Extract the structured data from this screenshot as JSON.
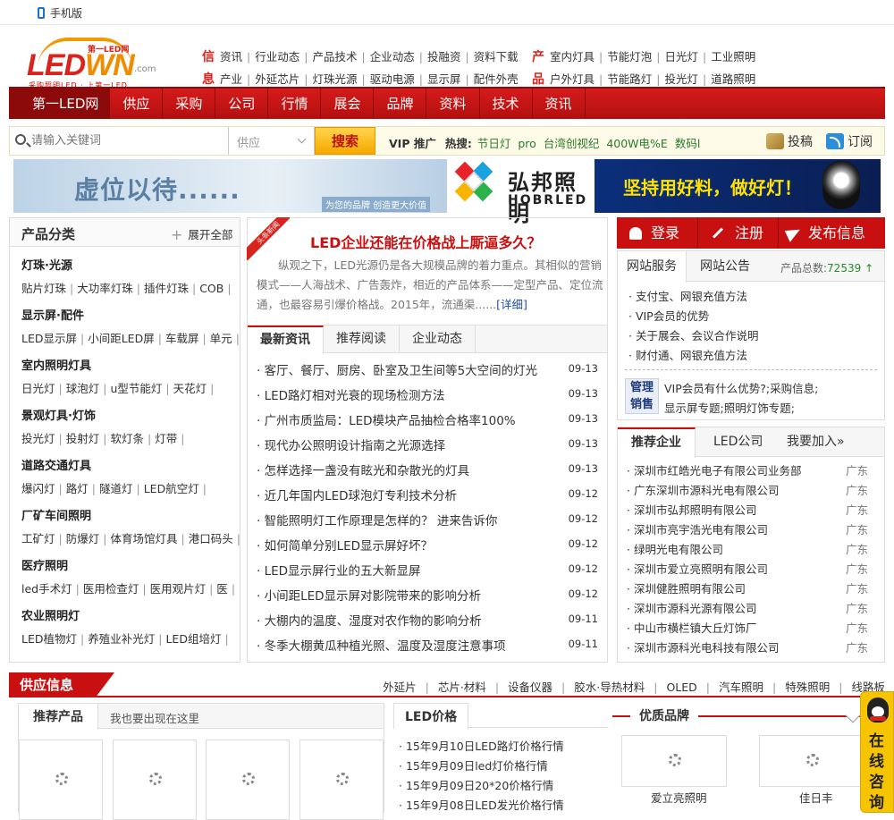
{
  "topbar": {
    "mobile_label": "手机版"
  },
  "logo": {
    "text_a": "LED",
    "text_b": "WN",
    "cn_text": "第一LED网",
    "com": ".com",
    "slogan": "采购照明LED · 上第一LED"
  },
  "header_links": {
    "xin_tag": "信",
    "xin_items": [
      "资讯",
      "行业动态",
      "产品技术",
      "企业动态",
      "投融资",
      "资料下载"
    ],
    "xi_tag": "息",
    "xi_items": [
      "产业",
      "外延芯片",
      "灯珠光源",
      "驱动电源",
      "显示屏",
      "配件外壳"
    ],
    "chan_tag": "产",
    "chan_items": [
      "室内灯具",
      "节能灯泡",
      "日光灯",
      "工业照明"
    ],
    "pin_tag": "品",
    "pin_items": [
      "户外灯具",
      "节能路灯",
      "投光灯",
      "道路照明"
    ]
  },
  "nav": {
    "items": [
      "第一LED网",
      "供应",
      "采购",
      "公司",
      "行情",
      "展会",
      "品牌",
      "资料",
      "技术",
      "资讯"
    ]
  },
  "search": {
    "placeholder": "请输入关键词",
    "select_value": "供应",
    "button": "搜索",
    "vip_label": "VIP 推广",
    "hot_label": "热搜:",
    "hot_keywords": [
      "节日灯",
      "pro",
      "台湾创视纪",
      "400W电%E",
      "数码l"
    ],
    "submit_label": "投稿",
    "rss_label": "订阅"
  },
  "banners": {
    "ban1_title": "虚位以待......",
    "ban1_sub": "为您的品牌 创造更大价值",
    "ban2_cn": "弘邦照明",
    "ban2_en": "HOBRLED",
    "ban3_title": "坚持用好料，做好灯！"
  },
  "categories": {
    "title": "产品分类",
    "expand": "展开全部",
    "groups": [
      {
        "title": "灯珠·光源",
        "items": [
          "贴片灯珠",
          "大功率灯珠",
          "插件灯珠",
          "COB"
        ]
      },
      {
        "title": "显示屏·配件",
        "items": [
          "LED显示屏",
          "小间距LED屏",
          "车载屏",
          "单元"
        ]
      },
      {
        "title": "室内照明灯具",
        "items": [
          "日光灯",
          "球泡灯",
          "u型节能灯",
          "天花灯"
        ]
      },
      {
        "title": "景观灯具·灯饰",
        "items": [
          "投光灯",
          "投射灯",
          "软灯条",
          "灯带"
        ]
      },
      {
        "title": "道路交通灯具",
        "items": [
          "爆闪灯",
          "路灯",
          "隧道灯",
          "LED航空灯"
        ]
      },
      {
        "title": "厂矿车间照明",
        "items": [
          "工矿灯",
          "防爆灯",
          "体育场馆灯具",
          "港口码头"
        ]
      },
      {
        "title": "医疗照明",
        "items": [
          "led手术灯",
          "医用检查灯",
          "医用观片灯",
          "医"
        ]
      },
      {
        "title": "农业照明灯",
        "items": [
          "LED植物灯",
          "养殖业补光灯",
          "LED组培灯"
        ]
      }
    ]
  },
  "focus": {
    "ribbon": "头条新闻",
    "headline": "LED企业还能在价格战上厮逼多久？",
    "summary": "纵观之下，LED光源仍是各大规模品牌的着力重点。其相似的营销模式——人海战术、广告轰炸，相近的产品体系——定型产品、定位流通，也最容易引爆价格战。2015年，流通渠......",
    "more": "[详细]"
  },
  "news": {
    "tabs": [
      "最新资讯",
      "推荐阅读",
      "企业动态"
    ],
    "items": [
      {
        "title": "· 客厅、餐厅、厨房、卧室及卫生间等5大空间的灯光",
        "date": "09-13"
      },
      {
        "title": "· LED路灯相对光衰的现场检测方法",
        "date": "09-13"
      },
      {
        "title": "· 广州市质监局：LED模块产品抽检合格率100%",
        "date": "09-13"
      },
      {
        "title": "· 现代办公照明设计指南之光源选择",
        "date": "09-13"
      },
      {
        "title": "· 怎样选择一盏没有眩光和杂散光的灯具",
        "date": "09-13"
      },
      {
        "title": "· 近几年国内LED球泡灯专利技术分析",
        "date": "09-12"
      },
      {
        "title": "· 智能照明灯工作原理是怎样的？ 进来告诉你",
        "date": "09-12"
      },
      {
        "title": "· 如何简单分别LED显示屏好坏？",
        "date": "09-12"
      },
      {
        "title": "· LED显示屏行业的五大新显屏",
        "date": "09-12"
      },
      {
        "title": "· 小间距LED显示屏对影院带来的影响分析",
        "date": "09-12"
      },
      {
        "title": "· 大棚内的温度、湿度对农作物的影响分析",
        "date": "09-11"
      },
      {
        "title": "· 冬季大棚黄瓜种植光照、温度及湿度注意事项",
        "date": "09-11"
      }
    ]
  },
  "auth": {
    "login": "登录",
    "register": "注册",
    "publish": "发布信息"
  },
  "service": {
    "tabs": [
      "网站服务",
      "网站公告"
    ],
    "count_label": "产品总数:",
    "count_value": "72539",
    "items": [
      "· 支付宝、网银充值方法",
      "· VIP会员的优势",
      "· 关于展会、会议合作说明",
      "· 财付通、网银充值方法"
    ],
    "mgmt_badge": "管理销售",
    "mgmt_lines": [
      "VIP会员有什么优势?;采购信息;",
      "显示屏专题;照明灯饰专题;"
    ]
  },
  "enterprises": {
    "tabs": [
      "推荐企业",
      "LED公司",
      "我要加入»"
    ],
    "items": [
      {
        "name": "· 深圳市红皓光电子有限公司业务部",
        "loc": "广东"
      },
      {
        "name": "· 广东深圳市源科光电有限公司",
        "loc": "广东"
      },
      {
        "name": "· 深圳市弘邦照明有限公司",
        "loc": "广东"
      },
      {
        "name": "· 深圳市亮宇浩光电有限公司",
        "loc": "广东"
      },
      {
        "name": "· 绿明光电有限公司",
        "loc": "广东"
      },
      {
        "name": "· 深圳市爱立亮照明有限公司",
        "loc": "广东"
      },
      {
        "name": "· 深圳健胜照明有限公司",
        "loc": "广东"
      },
      {
        "name": "· 深圳市源科光源有限公司",
        "loc": "广东"
      },
      {
        "name": "· 中山市横栏镇大丘灯饰厂",
        "loc": "广东"
      },
      {
        "name": "· 深圳市源科光电科技有限公司",
        "loc": "广东"
      }
    ]
  },
  "supply": {
    "title": "供应信息",
    "links": [
      "外延片",
      "芯片·材料",
      "设备仪器",
      "胶水·导热材料",
      "OLED",
      "汽车照明",
      "特殊照明",
      "线路板"
    ],
    "rec_tab": "推荐产品",
    "rec_hint": "我也要出现在这里",
    "price_tab": "LED价格",
    "price_items": [
      "· 15年9月10日LED路灯价格行情",
      "· 15年9月09日led灯价格行情",
      "· 15年9月09日20*20价格行情",
      "· 15年9月08日LED发光价格行情"
    ],
    "brand_title": "优质品牌",
    "brands": [
      "爱立亮照明",
      "佳日丰"
    ]
  },
  "consult": {
    "label": "在线咨询"
  },
  "colors": {
    "brand_red": "#c81010",
    "accent_orange": "#f39800",
    "link_green": "#2a7a2a"
  }
}
